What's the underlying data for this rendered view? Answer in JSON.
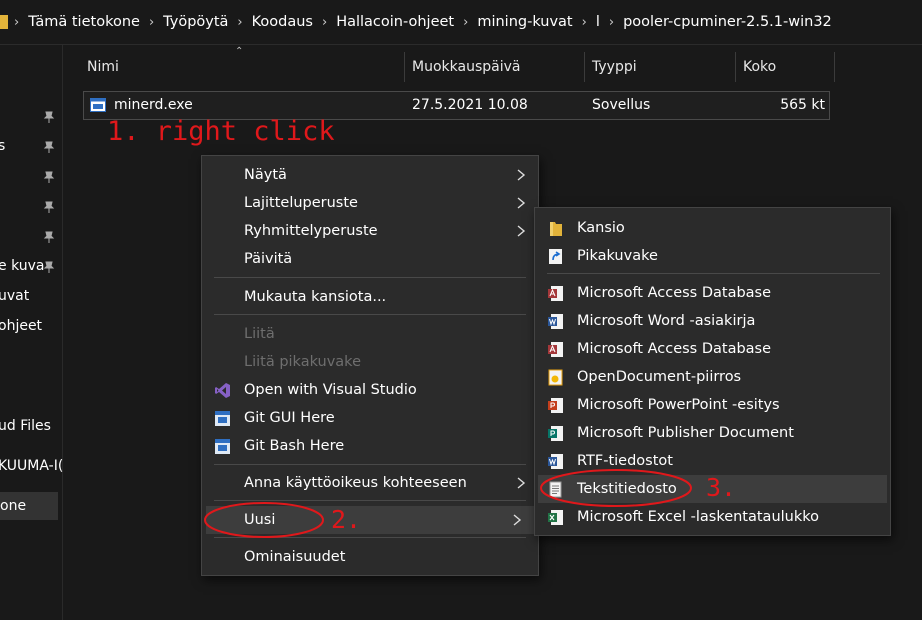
{
  "addressbar": {
    "crumbs": [
      "Tämä tietokone",
      "Työpöytä",
      "Koodaus",
      "Hallacoin-ohjeet",
      "mining-kuvat",
      "l",
      "pooler-cpuminer-2.5.1-win32"
    ]
  },
  "sidebar": {
    "items": [
      "s",
      "e kuva",
      "uvat",
      "ohjeet",
      "ud Files",
      "KUUMA-I(",
      "one"
    ]
  },
  "columns": {
    "name": "Nimi",
    "modified": "Muokkauspäivä",
    "type": "Tyyppi",
    "size": "Koko"
  },
  "file": {
    "name": "minerd.exe",
    "modified": "27.5.2021 10.08",
    "type": "Sovellus",
    "size": "565 kt"
  },
  "annotations": {
    "step1": "1. right click",
    "step2": "2.",
    "step3": "3."
  },
  "context_menu": {
    "items": [
      "Näytä",
      "Lajitteluperuste",
      "Ryhmittelyperuste",
      "Päivitä",
      "Mukauta kansiota...",
      "Liitä",
      "Liitä pikakuvake",
      "Open with Visual Studio",
      "Git GUI Here",
      "Git Bash Here",
      "Anna käyttöoikeus kohteeseen",
      "Uusi",
      "Ominaisuudet"
    ]
  },
  "submenu": {
    "items": [
      "Kansio",
      "Pikakuvake",
      "Microsoft Access Database",
      "Microsoft Word -asiakirja",
      "Microsoft Access Database",
      "OpenDocument-piirros",
      "Microsoft PowerPoint -esitys",
      "Microsoft Publisher Document",
      "RTF-tiedostot",
      "Tekstitiedosto",
      "Microsoft Excel -laskentataulukko"
    ]
  },
  "colors": {
    "background": "#191919",
    "menu": "#2b2b2b",
    "annotation": "#e0181b"
  }
}
